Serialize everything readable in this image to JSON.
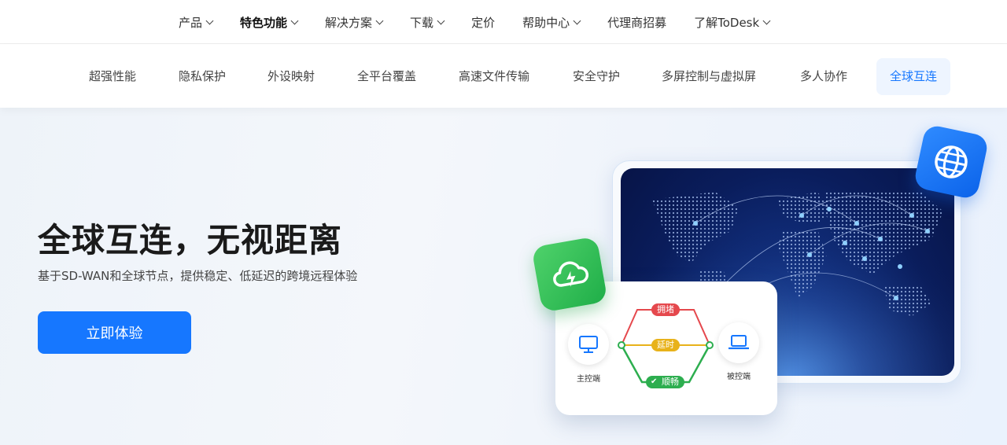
{
  "topnav": {
    "items": [
      {
        "label": "产品",
        "has_dropdown": true,
        "active": false
      },
      {
        "label": "特色功能",
        "has_dropdown": true,
        "active": true
      },
      {
        "label": "解决方案",
        "has_dropdown": true,
        "active": false
      },
      {
        "label": "下载",
        "has_dropdown": true,
        "active": false
      },
      {
        "label": "定价",
        "has_dropdown": false,
        "active": false
      },
      {
        "label": "帮助中心",
        "has_dropdown": true,
        "active": false
      },
      {
        "label": "代理商招募",
        "has_dropdown": false,
        "active": false
      },
      {
        "label": "了解ToDesk",
        "has_dropdown": true,
        "active": false
      }
    ]
  },
  "subnav": {
    "items": [
      {
        "label": "超强性能"
      },
      {
        "label": "隐私保护"
      },
      {
        "label": "外设映射"
      },
      {
        "label": "全平台覆盖"
      },
      {
        "label": "高速文件传输"
      },
      {
        "label": "安全守护"
      },
      {
        "label": "多屏控制与虚拟屏"
      },
      {
        "label": "多人协作"
      },
      {
        "label": "全球互连",
        "active": true
      }
    ]
  },
  "hero": {
    "title": "全球互连，无视距离",
    "subtitle": "基于SD-WAN和全球节点，提供稳定、低延迟的跨境远程体验",
    "cta_label": "立即体验"
  },
  "illustration": {
    "controller_label": "主控端",
    "controlled_label": "被控端",
    "route_congested": "拥堵",
    "route_delay": "延时",
    "route_smooth": "顺畅",
    "colors": {
      "congested": "#e5484d",
      "delay": "#e8b21a",
      "smooth": "#2dae4f",
      "accent": "#1677ff"
    }
  }
}
